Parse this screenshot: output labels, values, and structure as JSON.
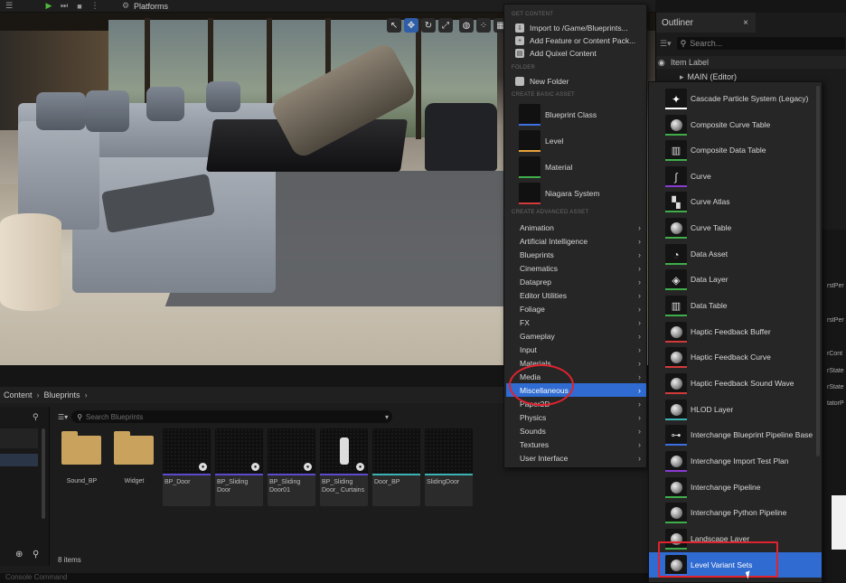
{
  "toolbar": {
    "platforms_label": "Platforms"
  },
  "outliner": {
    "tab_label": "Outliner",
    "close_glyph": "×",
    "search_placeholder": "Search...",
    "column_header": "Item Label",
    "row_label": "MAIN (Editor)"
  },
  "details": {
    "fragments": [
      "rstPer",
      "rstPer",
      "rCont",
      "rState",
      "rState",
      "tatorP"
    ]
  },
  "content_browser": {
    "breadcrumb": [
      "Content",
      "Blueprints"
    ],
    "search_placeholder": "Search Blueprints",
    "item_count": "8 items",
    "folders": [
      "Sound_BP",
      "Widget"
    ],
    "assets": [
      {
        "label": "BP_Door",
        "bar": "purple"
      },
      {
        "label": "BP_Sliding Door",
        "bar": "purple"
      },
      {
        "label": "BP_Sliding Door01",
        "bar": "purple"
      },
      {
        "label": "BP_Sliding Door_ Curtains",
        "bar": "purple"
      },
      {
        "label": "Door_BP",
        "bar": "teal"
      },
      {
        "label": "SlidingDoor",
        "bar": "teal"
      }
    ],
    "console_placeholder": "Console Command"
  },
  "menu": {
    "sections": {
      "get_content": "GET CONTENT",
      "folder": "FOLDER",
      "create_basic": "CREATE BASIC ASSET",
      "create_advanced": "CREATE ADVANCED ASSET"
    },
    "get_content_items": [
      "Import to /Game/Blueprints...",
      "Add Feature or Content Pack...",
      "Add Quixel Content"
    ],
    "folder_item": "New Folder",
    "basic_assets": [
      {
        "label": "Blueprint Class",
        "color": "#3c6fe0"
      },
      {
        "label": "Level",
        "color": "#e8a23a"
      },
      {
        "label": "Material",
        "color": "#3fae4a"
      },
      {
        "label": "Niagara System",
        "color": "#d23a3a"
      }
    ],
    "categories": [
      "Animation",
      "Artificial Intelligence",
      "Blueprints",
      "Cinematics",
      "Dataprep",
      "Editor Utilities",
      "Foliage",
      "FX",
      "Gameplay",
      "Input",
      "Materials",
      "Media",
      "Miscellaneous",
      "Paper2D",
      "Physics",
      "Sounds",
      "Textures",
      "User Interface"
    ],
    "highlighted": "Miscellaneous"
  },
  "submenu": {
    "items": [
      {
        "label": "Cascade Particle System (Legacy)",
        "icon": "particle-icon",
        "color": "#ffffff"
      },
      {
        "label": "Composite Curve Table",
        "icon": "sphere-icon",
        "color": "#3fae4a"
      },
      {
        "label": "Composite Data Table",
        "icon": "table-icon",
        "color": "#3fae4a"
      },
      {
        "label": "Curve",
        "icon": "curve-icon",
        "color": "#8a3ad2"
      },
      {
        "label": "Curve Atlas",
        "icon": "checker-icon",
        "color": "#3fae4a"
      },
      {
        "label": "Curve Table",
        "icon": "sphere-icon",
        "color": "#3fae4a"
      },
      {
        "label": "Data Asset",
        "icon": "pie-icon",
        "color": "#3fae4a"
      },
      {
        "label": "Data Layer",
        "icon": "layer-icon",
        "color": "#3fae4a"
      },
      {
        "label": "Data Table",
        "icon": "table-icon",
        "color": "#3fae4a"
      },
      {
        "label": "Haptic Feedback Buffer",
        "icon": "sphere-icon",
        "color": "#d23a3a"
      },
      {
        "label": "Haptic Feedback Curve",
        "icon": "sphere-icon",
        "color": "#d23a3a"
      },
      {
        "label": "Haptic Feedback Sound Wave",
        "icon": "sphere-icon",
        "color": "#d23a3a"
      },
      {
        "label": "HLOD Layer",
        "icon": "sphere-icon",
        "color": "#3bb3b3"
      },
      {
        "label": "Interchange Blueprint Pipeline Base",
        "icon": "blueprint-icon",
        "color": "#3c6fe0"
      },
      {
        "label": "Interchange Import Test Plan",
        "icon": "sphere-icon",
        "color": "#8a3ad2"
      },
      {
        "label": "Interchange Pipeline",
        "icon": "sphere-icon",
        "color": "#3fae4a"
      },
      {
        "label": "Interchange Python Pipeline",
        "icon": "sphere-icon",
        "color": "#3fae4a"
      },
      {
        "label": "Landscape Layer",
        "icon": "sphere-icon",
        "color": "#3fae4a"
      },
      {
        "label": "Level Variant Sets",
        "icon": "sphere-icon",
        "color": "#3c6fe0"
      }
    ],
    "highlighted": "Level Variant Sets"
  },
  "colors": {
    "accent": "#2f6bd1",
    "annotation": "#e0232e"
  }
}
